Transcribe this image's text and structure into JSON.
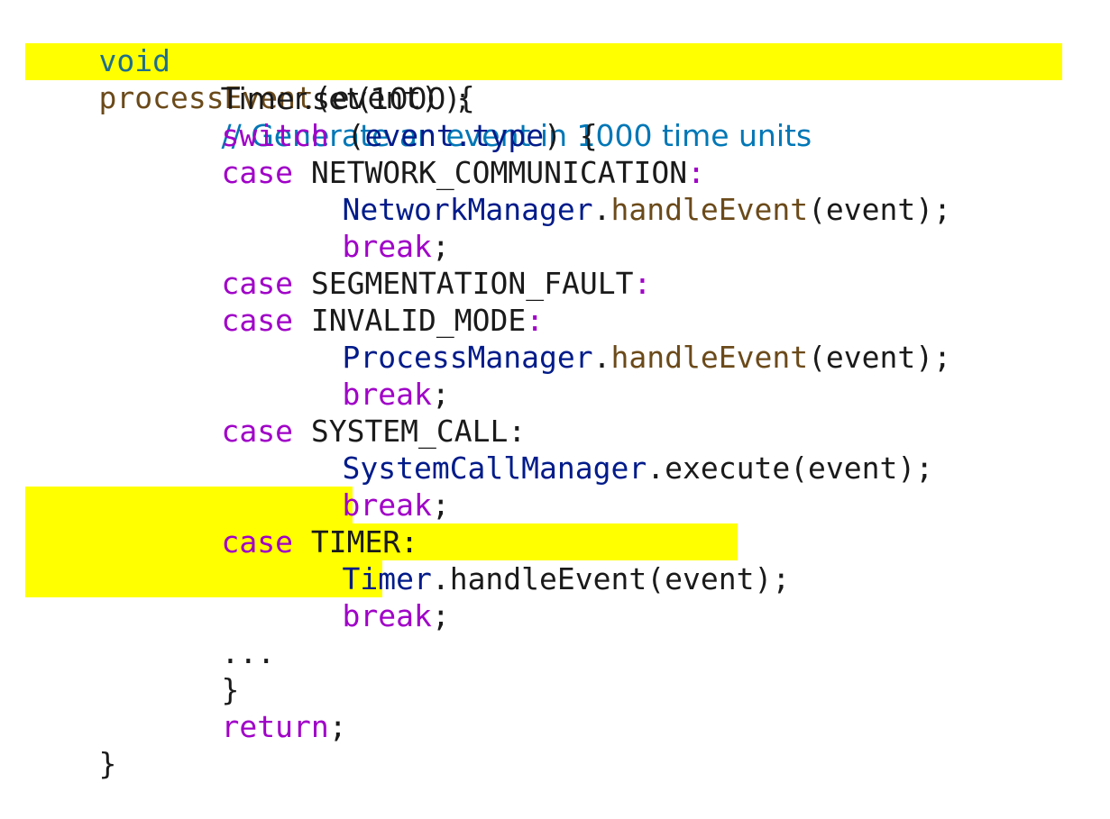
{
  "code": {
    "l1": {
      "void": "void",
      "fn": "processEvent",
      "rest": "(event) {"
    },
    "l2": {
      "call": "Timer.set(1000);",
      "comment": "// Generate an event in 1000 time units"
    },
    "l3": {
      "kw": "switch",
      "open": " (",
      "expr": "event.type",
      "close": ") {"
    },
    "l4": {
      "kw": "case",
      "label": " NETWORK_COMMUNICATION",
      "colon": ":"
    },
    "l5": {
      "cls": "NetworkManager",
      "dot": ".",
      "fn": "handleEvent",
      "args": "(event);"
    },
    "l6": {
      "kw": "break",
      "semi": ";"
    },
    "l7": {
      "kw": "case",
      "label": " SEGMENTATION_FAULT",
      "colon": ":"
    },
    "l8": {
      "kw": "case",
      "label": " INVALID_MODE",
      "colon": ":"
    },
    "l9": {
      "cls": "ProcessManager",
      "dot": ".",
      "fn": "handleEvent",
      "args": "(event);"
    },
    "l10": {
      "kw": "break",
      "semi": ";"
    },
    "l11": {
      "kw": "case",
      "label": " SYSTEM_CALL:"
    },
    "l12": {
      "cls": "SystemCallManager",
      "rest": ".execute(event);"
    },
    "l13": {
      "kw": "break",
      "semi": ";"
    },
    "l14": {
      "kw": "case",
      "label": " TIMER:"
    },
    "l15": {
      "cls": "Timer",
      "rest": ".handleEvent(event);"
    },
    "l16": {
      "kw": "break",
      "semi": ";"
    },
    "l17": {
      "text": "..."
    },
    "l18": {
      "text": "}"
    },
    "l19": {
      "kw": "return",
      "semi": ";"
    },
    "l20": {
      "text": "}"
    }
  },
  "colors": {
    "highlight": "#ffff00",
    "keyword": "#a000c8",
    "void": "#1f6f8b",
    "function": "#6b4a1a",
    "class": "#001b8a",
    "comment": "#0077b6"
  }
}
